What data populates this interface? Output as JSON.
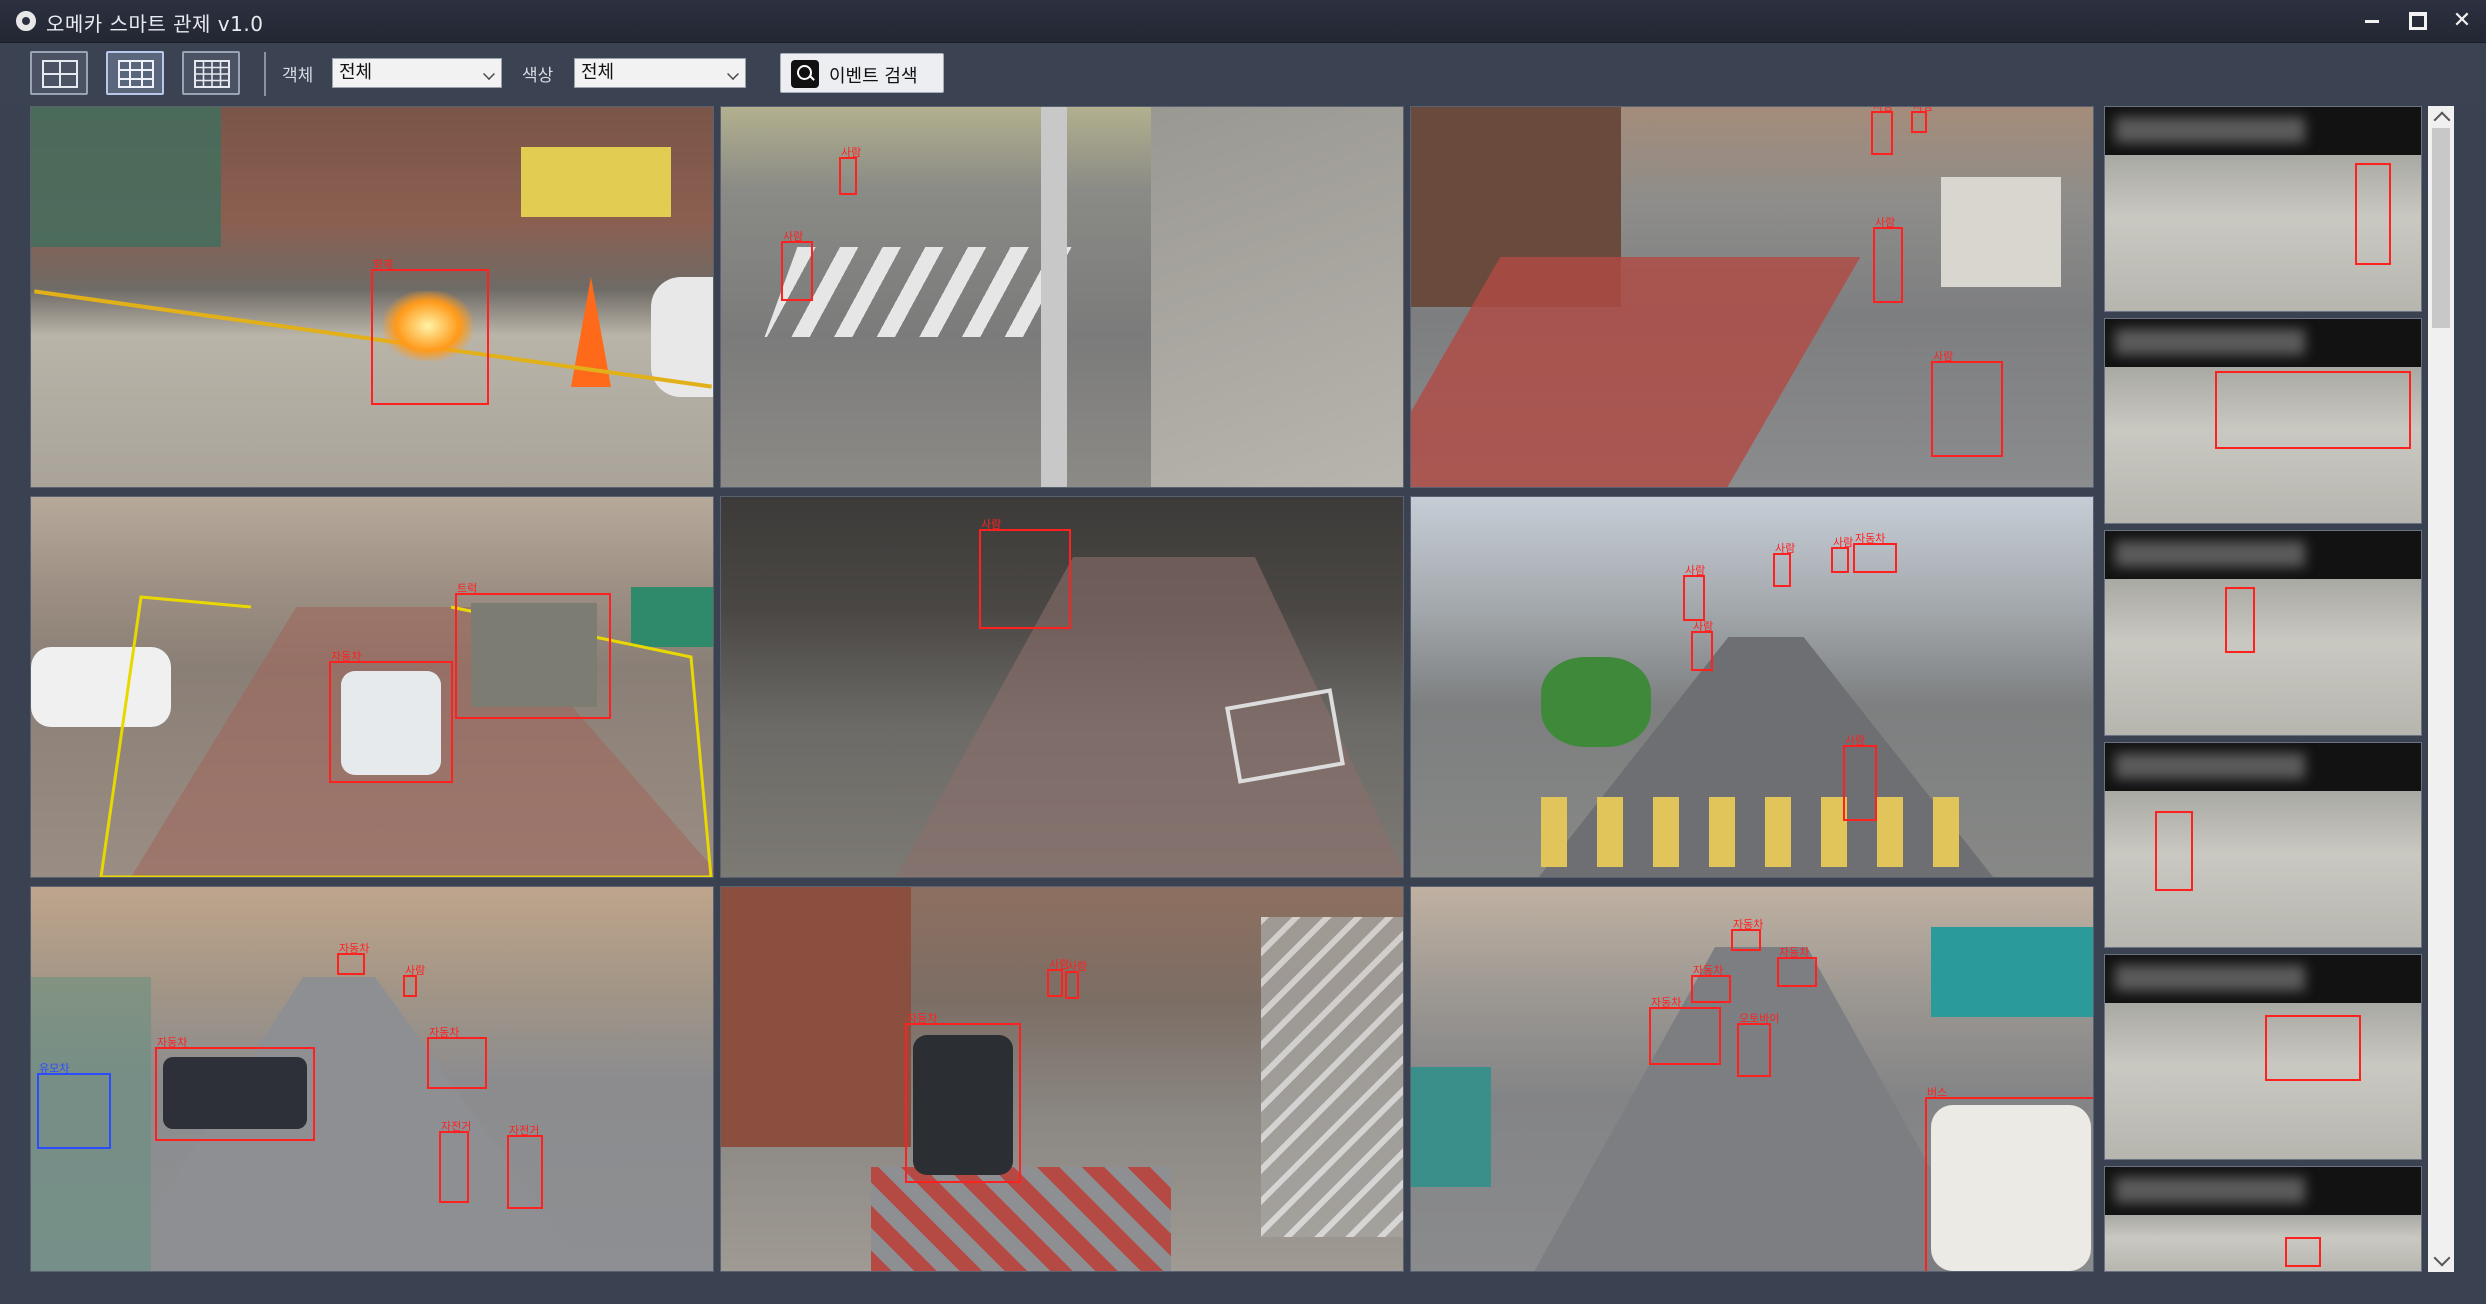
{
  "window": {
    "title": "오메카 스마트 관제 v1.0"
  },
  "toolbar": {
    "layouts": [
      "2x2",
      "3x3",
      "4x4"
    ],
    "object_label": "객체",
    "object_value": "전체",
    "color_label": "색상",
    "color_value": "전체",
    "search_label": "이벤트 검색"
  },
  "cameras": [
    {
      "id": "cam-1",
      "detections": [
        {
          "label": "화재"
        }
      ]
    },
    {
      "id": "cam-2",
      "detections": [
        {
          "label": "사람"
        },
        {
          "label": "사람"
        }
      ]
    },
    {
      "id": "cam-3",
      "detections": [
        {
          "label": "사람"
        },
        {
          "label": "사람"
        },
        {
          "label": "사람"
        },
        {
          "label": "사람"
        }
      ]
    },
    {
      "id": "cam-4",
      "detections": [
        {
          "label": "자동차"
        },
        {
          "label": "트럭"
        }
      ]
    },
    {
      "id": "cam-5",
      "detections": [
        {
          "label": "사람"
        }
      ]
    },
    {
      "id": "cam-6",
      "detections": [
        {
          "label": "사람"
        },
        {
          "label": "사람"
        },
        {
          "label": "사람"
        },
        {
          "label": "자동차"
        },
        {
          "label": "사람"
        },
        {
          "label": "사람"
        }
      ]
    },
    {
      "id": "cam-7",
      "detections": [
        {
          "label": "유모차"
        },
        {
          "label": "자동차"
        },
        {
          "label": "자동차"
        },
        {
          "label": "자전거"
        },
        {
          "label": "자전거"
        },
        {
          "label": "자동차"
        },
        {
          "label": "사람"
        }
      ]
    },
    {
      "id": "cam-8",
      "detections": [
        {
          "label": "자동차"
        },
        {
          "label": "사람"
        },
        {
          "label": "사람"
        }
      ]
    },
    {
      "id": "cam-9",
      "detections": [
        {
          "label": "자동차"
        },
        {
          "label": "오토바이"
        },
        {
          "label": "버스"
        },
        {
          "label": "자동차"
        },
        {
          "label": "자동차"
        },
        {
          "label": "자동차"
        }
      ]
    }
  ],
  "event_thumbnails": [
    {
      "type": "사람"
    },
    {
      "type": "자동차"
    },
    {
      "type": "사람"
    },
    {
      "type": "사람"
    },
    {
      "type": "자동차"
    },
    {
      "type": "사람"
    }
  ],
  "colors": {
    "detection_box": "#ff2020",
    "zone_line": "#e8d800",
    "stroller_box": "#2c4cff",
    "window_bg": "#3a4150"
  }
}
